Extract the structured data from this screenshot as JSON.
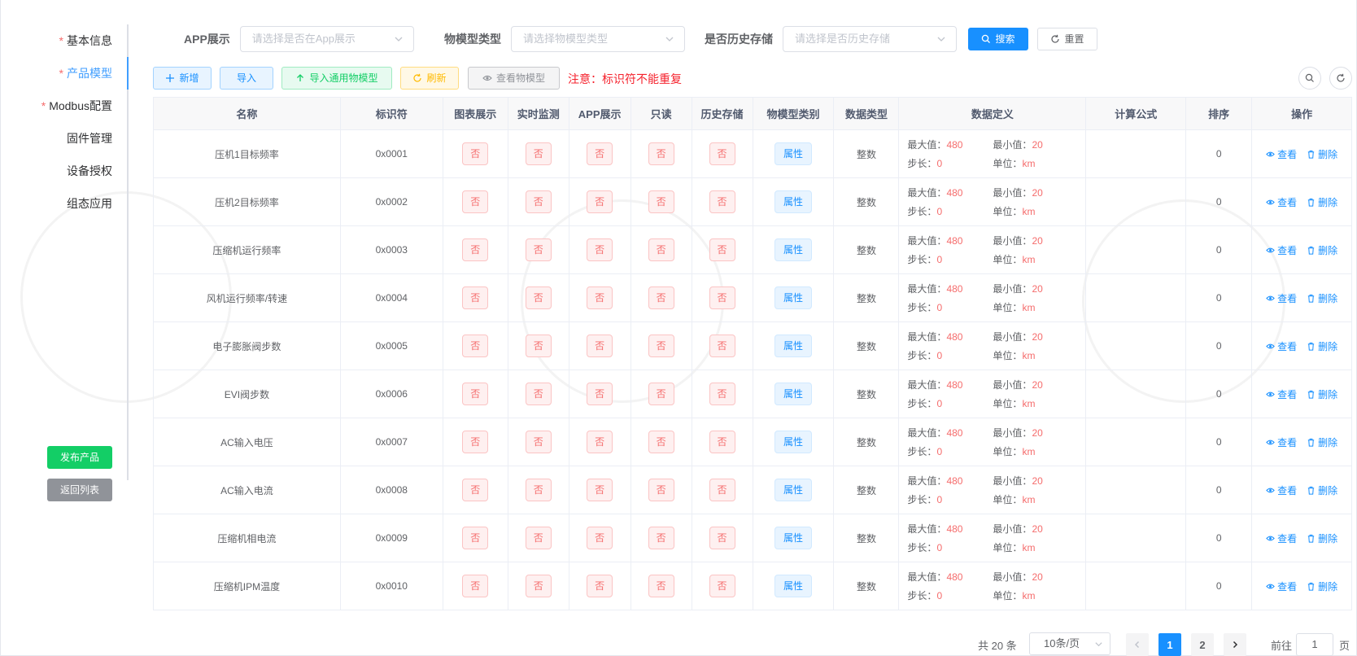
{
  "sidebar": {
    "items": [
      {
        "label": "基本信息",
        "required": "*",
        "active": false
      },
      {
        "label": "产品模型",
        "required": "*",
        "active": true
      },
      {
        "label": "Modbus配置",
        "required": "*",
        "active": false
      },
      {
        "label": "固件管理",
        "required": "",
        "active": false
      },
      {
        "label": "设备授权",
        "required": "",
        "active": false
      },
      {
        "label": "组态应用",
        "required": "",
        "active": false
      }
    ],
    "publish_label": "发布产品",
    "back_label": "返回列表"
  },
  "filters": {
    "app_label": "APP展示",
    "app_placeholder": "请选择是否在App展示",
    "type_label": "物模型类型",
    "type_placeholder": "请选择物模型类型",
    "history_label": "是否历史存储",
    "history_placeholder": "请选择是否历史存储",
    "search_label": "搜索",
    "reset_label": "重置"
  },
  "toolbar": {
    "add_label": "新增",
    "import_label": "导入",
    "import_common_label": "导入通用物模型",
    "refresh_label": "刷新",
    "view_model_label": "查看物模型",
    "notice": "注意：标识符不能重复"
  },
  "table": {
    "headers": [
      "名称",
      "标识符",
      "图表展示",
      "实时监测",
      "APP展示",
      "只读",
      "历史存储",
      "物模型类别",
      "数据类型",
      "数据定义",
      "计算公式",
      "排序",
      "操作"
    ],
    "def_labels": {
      "max": "最大值：",
      "min": "最小值：",
      "step": "步长：",
      "unit": "单位："
    },
    "op_view": "查看",
    "op_delete": "删除",
    "rows": [
      {
        "name": "压机1目标频率",
        "id": "0x0001",
        "chart": "否",
        "monitor": "否",
        "app": "否",
        "readonly": "否",
        "history": "否",
        "category": "属性",
        "dtype": "整数",
        "max": "480",
        "min": "20",
        "step": "0",
        "unit": "km",
        "formula": "",
        "sort": "0"
      },
      {
        "name": "压机2目标频率",
        "id": "0x0002",
        "chart": "否",
        "monitor": "否",
        "app": "否",
        "readonly": "否",
        "history": "否",
        "category": "属性",
        "dtype": "整数",
        "max": "480",
        "min": "20",
        "step": "0",
        "unit": "km",
        "formula": "",
        "sort": "0"
      },
      {
        "name": "压缩机运行频率",
        "id": "0x0003",
        "chart": "否",
        "monitor": "否",
        "app": "否",
        "readonly": "否",
        "history": "否",
        "category": "属性",
        "dtype": "整数",
        "max": "480",
        "min": "20",
        "step": "0",
        "unit": "km",
        "formula": "",
        "sort": "0"
      },
      {
        "name": "风机运行频率/转速",
        "id": "0x0004",
        "chart": "否",
        "monitor": "否",
        "app": "否",
        "readonly": "否",
        "history": "否",
        "category": "属性",
        "dtype": "整数",
        "max": "480",
        "min": "20",
        "step": "0",
        "unit": "km",
        "formula": "",
        "sort": "0"
      },
      {
        "name": "电子膨胀阀步数",
        "id": "0x0005",
        "chart": "否",
        "monitor": "否",
        "app": "否",
        "readonly": "否",
        "history": "否",
        "category": "属性",
        "dtype": "整数",
        "max": "480",
        "min": "20",
        "step": "0",
        "unit": "km",
        "formula": "",
        "sort": "0"
      },
      {
        "name": "EVI阀步数",
        "id": "0x0006",
        "chart": "否",
        "monitor": "否",
        "app": "否",
        "readonly": "否",
        "history": "否",
        "category": "属性",
        "dtype": "整数",
        "max": "480",
        "min": "20",
        "step": "0",
        "unit": "km",
        "formula": "",
        "sort": "0"
      },
      {
        "name": "AC输入电压",
        "id": "0x0007",
        "chart": "否",
        "monitor": "否",
        "app": "否",
        "readonly": "否",
        "history": "否",
        "category": "属性",
        "dtype": "整数",
        "max": "480",
        "min": "20",
        "step": "0",
        "unit": "km",
        "formula": "",
        "sort": "0"
      },
      {
        "name": "AC输入电流",
        "id": "0x0008",
        "chart": "否",
        "monitor": "否",
        "app": "否",
        "readonly": "否",
        "history": "否",
        "category": "属性",
        "dtype": "整数",
        "max": "480",
        "min": "20",
        "step": "0",
        "unit": "km",
        "formula": "",
        "sort": "0"
      },
      {
        "name": "压缩机相电流",
        "id": "0x0009",
        "chart": "否",
        "monitor": "否",
        "app": "否",
        "readonly": "否",
        "history": "否",
        "category": "属性",
        "dtype": "整数",
        "max": "480",
        "min": "20",
        "step": "0",
        "unit": "km",
        "formula": "",
        "sort": "0"
      },
      {
        "name": "压缩机IPM温度",
        "id": "0x0010",
        "chart": "否",
        "monitor": "否",
        "app": "否",
        "readonly": "否",
        "history": "否",
        "category": "属性",
        "dtype": "整数",
        "max": "480",
        "min": "20",
        "step": "0",
        "unit": "km",
        "formula": "",
        "sort": "0"
      }
    ]
  },
  "pagination": {
    "total": "共 20 条",
    "page_size": "10条/页",
    "pages": [
      "1",
      "2"
    ],
    "current": "1",
    "goto_prefix": "前往",
    "goto_value": "1",
    "goto_suffix": "页"
  },
  "colors": {
    "primary": "#1890ff",
    "success": "#13ce66",
    "warning": "#ffba00",
    "danger": "#f56c6c",
    "info": "#909399"
  }
}
